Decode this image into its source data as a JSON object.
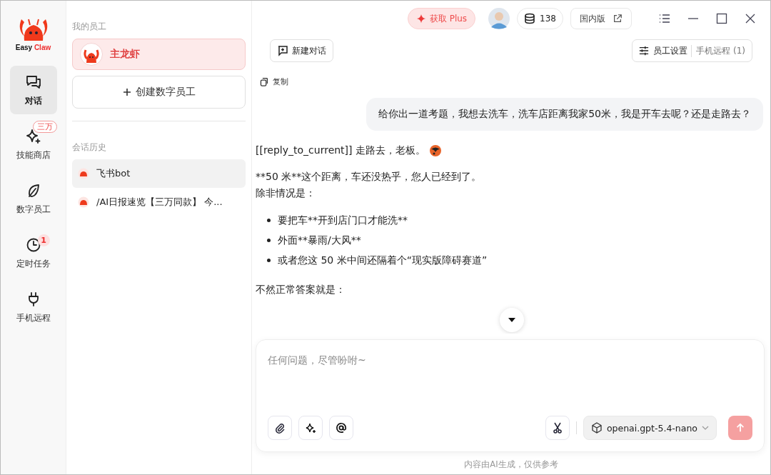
{
  "logo": {
    "text_a": "Easy",
    "text_b": "Claw"
  },
  "rail": [
    {
      "label": "对话",
      "selected": true
    },
    {
      "label": "技能商店",
      "selected": false,
      "badge": "三万"
    },
    {
      "label": "数字员工",
      "selected": false
    },
    {
      "label": "定时任务",
      "selected": false,
      "badge": "1"
    },
    {
      "label": "手机远程",
      "selected": false
    }
  ],
  "employees": {
    "heading": "我的员工",
    "items": [
      {
        "name": "主龙虾",
        "selected": true
      }
    ],
    "create_button": "创建数字员工"
  },
  "history": {
    "heading": "会话历史",
    "items": [
      {
        "title": "飞书bot",
        "selected": true
      },
      {
        "title": "/AI日报速览【三万同款】 今...",
        "selected": false
      }
    ]
  },
  "topbar": {
    "plus_button": "获取 Plus",
    "credits": "138",
    "domestic_button": "国内版"
  },
  "toolbar": {
    "new_chat": "新建对话",
    "settings": "员工设置",
    "remote": "手机远程 (1)"
  },
  "chat": {
    "copy": "复制",
    "user_message": "给你出一道考题，我想去洗车，洗车店距离我家50米，我是开车去呢？还是走路去？",
    "reply": [
      {
        "kind": "text",
        "text": "[[reply_to_current]] 走路去，老板。",
        "emoji": true
      },
      {
        "kind": "lines",
        "lines": [
          "**50 米**这个距离，车还没热乎，您人已经到了。",
          "除非情况是："
        ]
      },
      {
        "kind": "list",
        "items": [
          "要把车**开到店门口才能洗**",
          "外面**暴雨/大风**",
          "或者您这 50 米中间还隔着个“现实版障碍赛道”"
        ]
      },
      {
        "kind": "text",
        "text": "不然正常答案就是："
      }
    ]
  },
  "composer": {
    "placeholder": "任何问题，尽管吩咐~",
    "model": "openai.gpt-5.4-nano"
  },
  "footer": "内容由AI生成，仅供参考"
}
